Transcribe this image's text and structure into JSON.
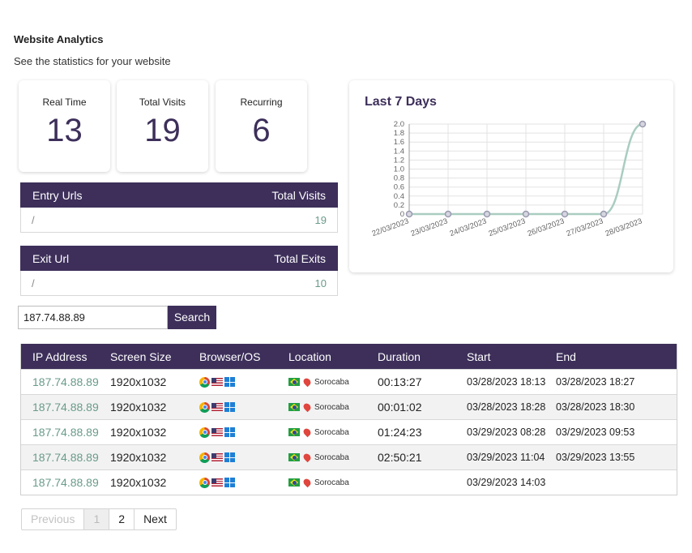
{
  "page": {
    "title": "Website Analytics",
    "subtitle": "See the statistics for your website"
  },
  "stats": [
    {
      "label": "Real Time",
      "value": "13"
    },
    {
      "label": "Total Visits",
      "value": "19"
    },
    {
      "label": "Recurring",
      "value": "6"
    }
  ],
  "entry_urls": {
    "headers": [
      "Entry Urls",
      "Total Visits"
    ],
    "rows": [
      {
        "url": "/",
        "count": "19"
      }
    ]
  },
  "exit_urls": {
    "headers": [
      "Exit Url",
      "Total Exits"
    ],
    "rows": [
      {
        "url": "/",
        "count": "10"
      }
    ]
  },
  "search": {
    "value": "187.74.88.89",
    "button_label": "Search"
  },
  "visits_table": {
    "headers": [
      "IP Address",
      "Screen Size",
      "Browser/OS",
      "Location",
      "Duration",
      "Start",
      "End"
    ],
    "rows": [
      {
        "ip": "187.74.88.89",
        "screen": "1920x1032",
        "browser": "chrome-icon",
        "country": "us-flag-icon",
        "os": "windows-icon",
        "flag": "brazil-flag-icon",
        "location": "Sorocaba",
        "duration": "00:13:27",
        "start": "03/28/2023 18:13",
        "end": "03/28/2023 18:27"
      },
      {
        "ip": "187.74.88.89",
        "screen": "1920x1032",
        "browser": "chrome-icon",
        "country": "us-flag-icon",
        "os": "windows-icon",
        "flag": "brazil-flag-icon",
        "location": "Sorocaba",
        "duration": "00:01:02",
        "start": "03/28/2023 18:28",
        "end": "03/28/2023 18:30"
      },
      {
        "ip": "187.74.88.89",
        "screen": "1920x1032",
        "browser": "chrome-icon",
        "country": "us-flag-icon",
        "os": "windows-icon",
        "flag": "brazil-flag-icon",
        "location": "Sorocaba",
        "duration": "01:24:23",
        "start": "03/29/2023 08:28",
        "end": "03/29/2023 09:53"
      },
      {
        "ip": "187.74.88.89",
        "screen": "1920x1032",
        "browser": "chrome-icon",
        "country": "us-flag-icon",
        "os": "windows-icon",
        "flag": "brazil-flag-icon",
        "location": "Sorocaba",
        "duration": "02:50:21",
        "start": "03/29/2023 11:04",
        "end": "03/29/2023 13:55"
      },
      {
        "ip": "187.74.88.89",
        "screen": "1920x1032",
        "browser": "chrome-icon",
        "country": "us-flag-icon",
        "os": "windows-icon",
        "flag": "brazil-flag-icon",
        "location": "Sorocaba",
        "duration": "",
        "start": "03/29/2023 14:03",
        "end": ""
      }
    ]
  },
  "pagination": {
    "previous": "Previous",
    "pages": [
      "1",
      "2"
    ],
    "current": "1",
    "next": "Next"
  },
  "chart_data": {
    "type": "line",
    "title": "Last 7 Days",
    "x": [
      "22/03/2023",
      "23/03/2023",
      "24/03/2023",
      "25/03/2023",
      "26/03/2023",
      "27/03/2023",
      "28/03/2023"
    ],
    "series": [
      {
        "values": [
          0,
          0,
          0,
          0,
          0,
          0,
          2
        ]
      }
    ],
    "ylim": [
      0,
      2
    ],
    "yticks": [
      "0",
      "0.2",
      "0.4",
      "0.6",
      "0.8",
      "1.0",
      "1.2",
      "1.4",
      "1.6",
      "1.8",
      "2.0"
    ],
    "grid": true,
    "line_color": "#a9cdbf",
    "point_color": "#9a9ab0"
  },
  "colors": {
    "accent": "#3d2f5a",
    "link": "#6a9b89"
  }
}
